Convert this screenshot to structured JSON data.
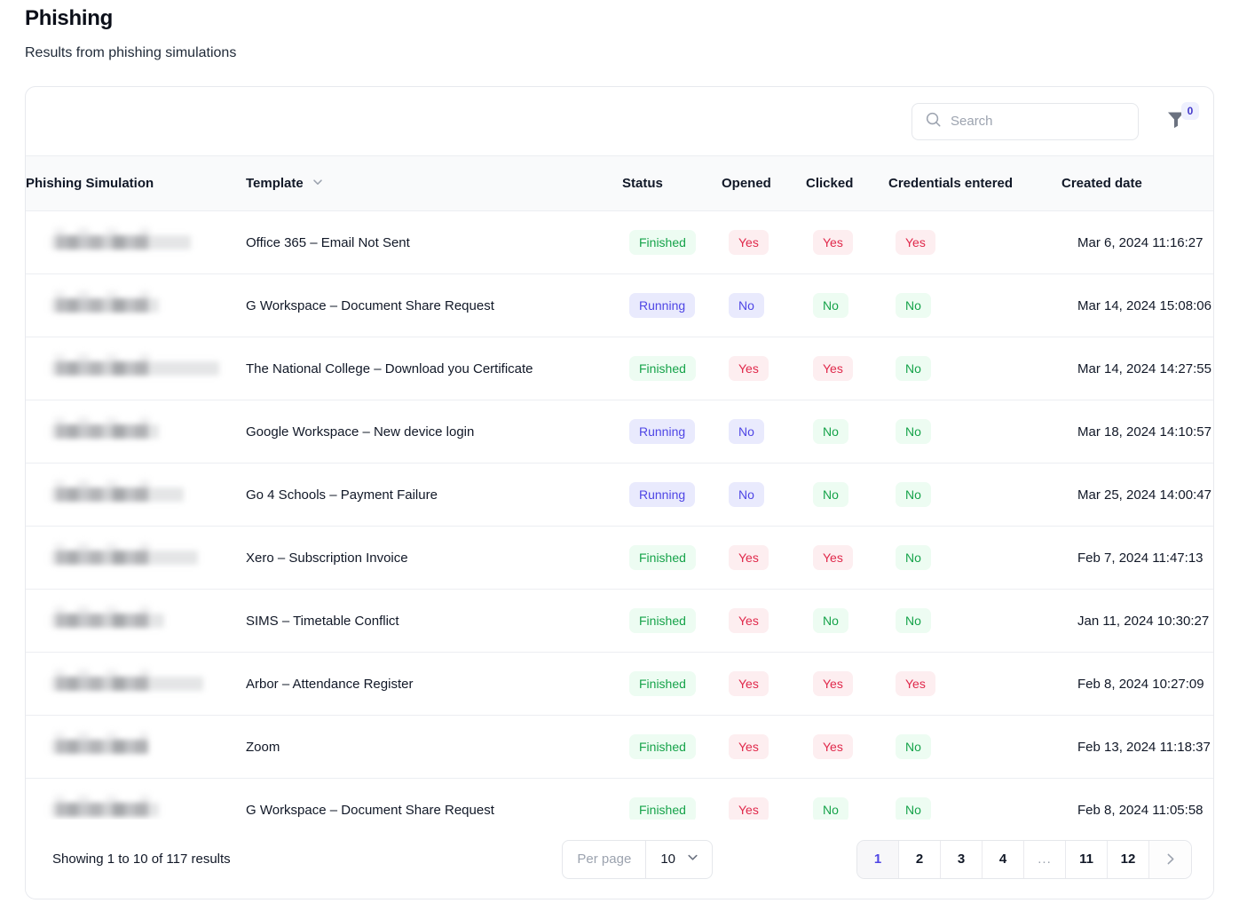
{
  "page": {
    "title": "Phishing",
    "subtitle": "Results from phishing simulations"
  },
  "toolbar": {
    "search_placeholder": "Search",
    "search_value": "",
    "filter_badge_count": "0"
  },
  "table": {
    "headers": {
      "simulation": "Phishing Simulation",
      "template": "Template",
      "status": "Status",
      "opened": "Opened",
      "clicked": "Clicked",
      "credentials": "Credentials entered",
      "created": "Created date"
    },
    "rows": [
      {
        "simulation": "",
        "template": "Office 365 – Email Not Sent",
        "status": "Finished",
        "status_tone": "green",
        "opened": "Yes",
        "opened_tone": "red",
        "clicked": "Yes",
        "clicked_tone": "red",
        "credentials": "Yes",
        "credentials_tone": "red",
        "created": "Mar 6, 2024 11:16:27"
      },
      {
        "simulation": "",
        "template": "G Workspace – Document Share Request",
        "status": "Running",
        "status_tone": "indigo",
        "opened": "No",
        "opened_tone": "indigo",
        "clicked": "No",
        "clicked_tone": "green",
        "credentials": "No",
        "credentials_tone": "green",
        "created": "Mar 14, 2024 15:08:06"
      },
      {
        "simulation": "",
        "template": "The National College – Download you Certificate",
        "status": "Finished",
        "status_tone": "green",
        "opened": "Yes",
        "opened_tone": "red",
        "clicked": "Yes",
        "clicked_tone": "red",
        "credentials": "No",
        "credentials_tone": "green",
        "created": "Mar 14, 2024 14:27:55"
      },
      {
        "simulation": "",
        "template": "Google Workspace – New device login",
        "status": "Running",
        "status_tone": "indigo",
        "opened": "No",
        "opened_tone": "indigo",
        "clicked": "No",
        "clicked_tone": "green",
        "credentials": "No",
        "credentials_tone": "green",
        "created": "Mar 18, 2024 14:10:57"
      },
      {
        "simulation": "",
        "template": "Go 4 Schools – Payment Failure",
        "status": "Running",
        "status_tone": "indigo",
        "opened": "No",
        "opened_tone": "indigo",
        "clicked": "No",
        "clicked_tone": "green",
        "credentials": "No",
        "credentials_tone": "green",
        "created": "Mar 25, 2024 14:00:47"
      },
      {
        "simulation": "",
        "template": "Xero – Subscription Invoice",
        "status": "Finished",
        "status_tone": "green",
        "opened": "Yes",
        "opened_tone": "red",
        "clicked": "Yes",
        "clicked_tone": "red",
        "credentials": "No",
        "credentials_tone": "green",
        "created": "Feb 7, 2024 11:47:13"
      },
      {
        "simulation": "",
        "template": "SIMS – Timetable Conflict",
        "status": "Finished",
        "status_tone": "green",
        "opened": "Yes",
        "opened_tone": "red",
        "clicked": "No",
        "clicked_tone": "green",
        "credentials": "No",
        "credentials_tone": "green",
        "created": "Jan 11, 2024 10:30:27"
      },
      {
        "simulation": "",
        "template": "Arbor – Attendance Register",
        "status": "Finished",
        "status_tone": "green",
        "opened": "Yes",
        "opened_tone": "red",
        "clicked": "Yes",
        "clicked_tone": "red",
        "credentials": "Yes",
        "credentials_tone": "red",
        "created": "Feb 8, 2024 10:27:09"
      },
      {
        "simulation": "",
        "template": "Zoom",
        "status": "Finished",
        "status_tone": "green",
        "opened": "Yes",
        "opened_tone": "red",
        "clicked": "Yes",
        "clicked_tone": "red",
        "credentials": "No",
        "credentials_tone": "green",
        "created": "Feb 13, 2024 11:18:37"
      },
      {
        "simulation": "",
        "template": "G Workspace – Document Share Request",
        "status": "Finished",
        "status_tone": "green",
        "opened": "Yes",
        "opened_tone": "red",
        "clicked": "No",
        "clicked_tone": "green",
        "credentials": "No",
        "credentials_tone": "green",
        "created": "Feb 8, 2024 11:05:58"
      }
    ]
  },
  "footer": {
    "showing": "Showing 1 to 10 of 117 results",
    "per_page_label": "Per page",
    "per_page_value": "10",
    "pages": [
      "1",
      "2",
      "3",
      "4",
      "...",
      "11",
      "12"
    ],
    "active_page": "1",
    "next_label": "›"
  },
  "colors": {
    "accent": "#4f46e5",
    "green": "#16a34a",
    "red": "#e0294b"
  }
}
